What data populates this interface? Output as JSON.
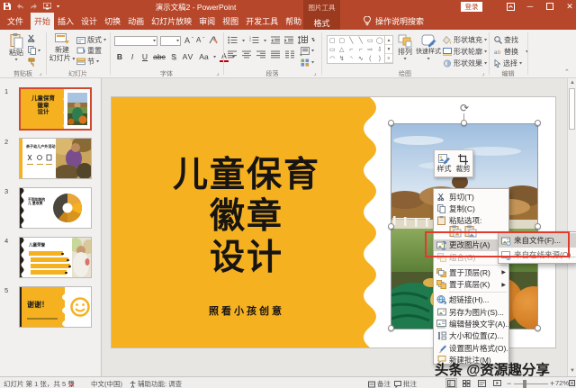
{
  "colors": {
    "accent": "#B7472A",
    "contextual_tab_bg": "#9C3A20",
    "slide_yellow": "#F5B120",
    "annotation_red": "#E23A2C",
    "menu_highlight": "#D5D1CD"
  },
  "titlebar": {
    "title": "演示文稿2 - PowerPoint",
    "contextual_tool": "图片工具",
    "signin_label": "登录",
    "qat_icons": [
      "save-icon",
      "undo-icon",
      "redo-icon",
      "start-slideshow-icon",
      "customize-qat-icon"
    ]
  },
  "tabs": {
    "file": "文件",
    "items": [
      {
        "label": "开始",
        "selected": true
      },
      {
        "label": "插入",
        "selected": false
      },
      {
        "label": "设计",
        "selected": false
      },
      {
        "label": "切换",
        "selected": false
      },
      {
        "label": "动画",
        "selected": false
      },
      {
        "label": "幻灯片放映",
        "selected": false
      },
      {
        "label": "审阅",
        "selected": false
      },
      {
        "label": "视图",
        "selected": false
      },
      {
        "label": "开发工具",
        "selected": false
      },
      {
        "label": "帮助",
        "selected": false
      }
    ],
    "contextual": "格式",
    "tellme": "操作说明搜索"
  },
  "ribbon": {
    "clipboard": {
      "label": "剪贴板",
      "paste": "粘贴"
    },
    "slides": {
      "label": "幻灯片",
      "new_slide_1": "新建",
      "new_slide_2": "幻灯片",
      "layout": "版式",
      "reset": "重置",
      "section": "节"
    },
    "font": {
      "label": "字体",
      "bold": "B",
      "italic": "I",
      "underline": "U",
      "strike": "abc",
      "shadow": "S",
      "spacing": "AV",
      "case": "Aa",
      "color": "A"
    },
    "paragraph": {
      "label": "段落"
    },
    "drawing": {
      "label": "绘图",
      "arrange": "排列",
      "quick_styles": "快速样式",
      "shape_fill": "形状填充",
      "shape_outline": "形状轮廓",
      "shape_effects": "形状效果"
    },
    "editing": {
      "label": "编辑",
      "find": "查找",
      "replace": "替换",
      "select": "选择"
    }
  },
  "thumbnails": [
    {
      "number": "1",
      "selected": true,
      "title_1": "儿童保育",
      "title_2": "徽章",
      "title_3": "设计"
    },
    {
      "number": "2",
      "selected": false,
      "title": "亲子幼儿户外活动"
    },
    {
      "number": "3",
      "selected": false,
      "title": "不同年龄的儿 童收费"
    },
    {
      "number": "4",
      "selected": false,
      "title": "儿童荣誉"
    },
    {
      "number": "5",
      "selected": false,
      "title": "谢谢！"
    }
  ],
  "slide": {
    "title_line_1": "儿童保育",
    "title_line_2": "徽章",
    "title_line_3": "设计",
    "subtitle": "照看小孩创意"
  },
  "mini_toolbar": {
    "style_label": "样式",
    "crop_label": "裁剪",
    "icons": [
      "picture-style-icon",
      "crop-icon"
    ]
  },
  "context_menu": {
    "items": [
      {
        "label": "剪切(T)",
        "icon": "scissors-icon"
      },
      {
        "label": "复制(C)",
        "icon": "copy-icon"
      },
      {
        "label": "粘贴选项:",
        "type": "caption"
      },
      {
        "type": "paste-options",
        "icons": [
          "paste-keep-format-icon",
          "paste-picture-icon"
        ]
      },
      {
        "label": "更改图片(A)",
        "icon": "change-picture-icon",
        "submenu": true,
        "highlighted": true
      },
      {
        "label": "组合(G)",
        "icon": "group-icon",
        "submenu": true,
        "disabled": true
      },
      {
        "label": "置于顶层(R)",
        "icon": "bring-to-front-icon",
        "submenu": true
      },
      {
        "label": "置于底层(K)",
        "icon": "send-to-back-icon",
        "submenu": true
      },
      {
        "label": "超链接(H)...",
        "icon": "hyperlink-icon"
      },
      {
        "label": "另存为图片(S)...",
        "icon": "save-picture-icon"
      },
      {
        "label": "编辑替换文字(A)...",
        "icon": "alt-text-icon"
      },
      {
        "label": "大小和位置(Z)...",
        "icon": "size-position-icon"
      },
      {
        "label": "设置图片格式(O)...",
        "icon": "format-picture-icon"
      },
      {
        "label": "新建批注(M)",
        "icon": "new-comment-icon"
      }
    ]
  },
  "submenu": {
    "items": [
      {
        "label": "来自文件(F)...",
        "icon": "from-file-icon",
        "highlighted": true
      },
      {
        "label": "来自在线来源(O)...",
        "icon": "from-online-icon",
        "highlighted": false
      }
    ]
  },
  "watermark": "头条 @资源趣分享",
  "statusbar": {
    "slide_info": "幻灯片 第 1 张，共 5 张",
    "language": "中文(中国)",
    "accessibility": "辅助功能: 调查",
    "notes": "备注",
    "comments": "批注",
    "zoom": "72%",
    "view_icons": [
      "normal-view-icon",
      "slide-sorter-icon",
      "reading-view-icon",
      "slideshow-icon"
    ]
  }
}
